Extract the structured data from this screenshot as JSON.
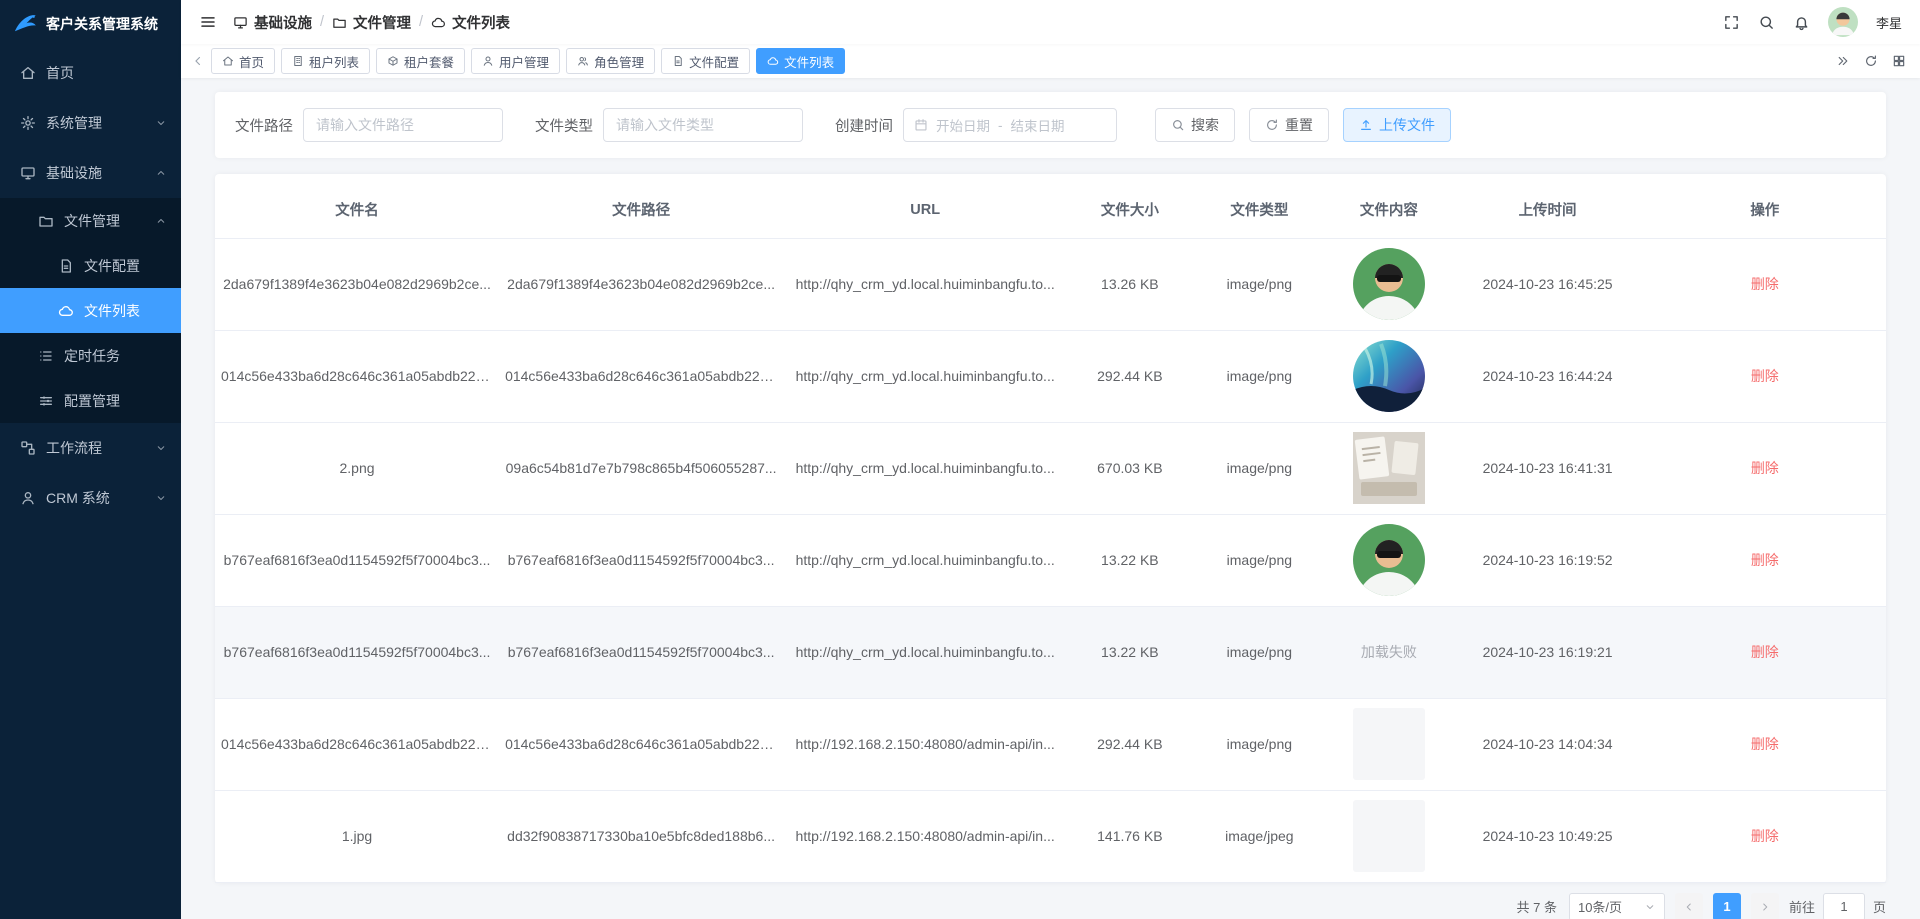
{
  "app": {
    "title": "客户关系管理系统"
  },
  "colors": {
    "accent": "#409eff",
    "sidebar_bg": "#0b2239",
    "danger": "#f56c6c"
  },
  "header": {
    "breadcrumb": [
      {
        "icon": "monitor",
        "label": "基础设施"
      },
      {
        "icon": "folder",
        "label": "文件管理"
      },
      {
        "icon": "cloud",
        "label": "文件列表"
      }
    ],
    "tools": [
      "fullscreen-icon",
      "search-icon",
      "bell-icon"
    ],
    "user_name": "李星"
  },
  "sidebar": {
    "items": [
      {
        "icon": "home",
        "label": "首页"
      },
      {
        "icon": "gear",
        "label": "系统管理"
      },
      {
        "icon": "monitor",
        "label": "基础设施"
      },
      {
        "icon": "folder",
        "label": "文件管理"
      },
      {
        "icon": "doc",
        "label": "文件配置"
      },
      {
        "icon": "cloud",
        "label": "文件列表"
      },
      {
        "icon": "list",
        "label": "定时任务"
      },
      {
        "icon": "sliders",
        "label": "配置管理"
      },
      {
        "icon": "flow",
        "label": "工作流程"
      },
      {
        "icon": "user",
        "label": "CRM 系统"
      }
    ]
  },
  "tabs": [
    {
      "icon": "home",
      "label": "首页"
    },
    {
      "icon": "building",
      "label": "租户列表"
    },
    {
      "icon": "package",
      "label": "租户套餐"
    },
    {
      "icon": "user",
      "label": "用户管理"
    },
    {
      "icon": "users",
      "label": "角色管理"
    },
    {
      "icon": "doc",
      "label": "文件配置"
    },
    {
      "icon": "cloud",
      "label": "文件列表",
      "active": true
    }
  ],
  "filters": {
    "path_label": "文件路径",
    "path_placeholder": "请输入文件路径",
    "type_label": "文件类型",
    "type_placeholder": "请输入文件类型",
    "time_label": "创建时间",
    "date_start": "开始日期",
    "date_separator": "-",
    "date_end": "结束日期",
    "search_label": "搜索",
    "reset_label": "重置",
    "upload_label": "上传文件"
  },
  "table": {
    "headers": [
      "文件名",
      "文件路径",
      "URL",
      "文件大小",
      "文件类型",
      "文件内容",
      "上传时间",
      "操作"
    ],
    "delete_label": "删除",
    "load_failed": "加载失败",
    "rows": [
      {
        "name": "2da679f1389f4e3623b04e082d2969b2ce...",
        "path": "2da679f1389f4e3623b04e082d2969b2ce...",
        "url": "http://qhy_crm_yd.local.huiminbangfu.to...",
        "size": "13.26 KB",
        "type": "image/png",
        "thumb": "avatar",
        "time": "2024-10-23 16:45:25"
      },
      {
        "name": "014c56e433ba6d28c646c361a05abdb225...",
        "path": "014c56e433ba6d28c646c361a05abdb225...",
        "url": "http://qhy_crm_yd.local.huiminbangfu.to...",
        "size": "292.44 KB",
        "type": "image/png",
        "thumb": "aurora",
        "time": "2024-10-23 16:44:24"
      },
      {
        "name": "2.png",
        "path": "09a6c54b81d7e7b798c865b4f506055287...",
        "url": "http://qhy_crm_yd.local.huiminbangfu.to...",
        "size": "670.03 KB",
        "type": "image/png",
        "thumb": "photo",
        "time": "2024-10-23 16:41:31"
      },
      {
        "name": "b767eaf6816f3ea0d1154592f5f70004bc3...",
        "path": "b767eaf6816f3ea0d1154592f5f70004bc3...",
        "url": "http://qhy_crm_yd.local.huiminbangfu.to...",
        "size": "13.22 KB",
        "type": "image/png",
        "thumb": "avatar",
        "time": "2024-10-23 16:19:52"
      },
      {
        "name": "b767eaf6816f3ea0d1154592f5f70004bc3...",
        "path": "b767eaf6816f3ea0d1154592f5f70004bc3...",
        "url": "http://qhy_crm_yd.local.huiminbangfu.to...",
        "size": "13.22 KB",
        "type": "image/png",
        "thumb": "failed",
        "time": "2024-10-23 16:19:21",
        "highlight": true
      },
      {
        "name": "014c56e433ba6d28c646c361a05abdb225...",
        "path": "014c56e433ba6d28c646c361a05abdb225...",
        "url": "http://192.168.2.150:48080/admin-api/in...",
        "size": "292.44 KB",
        "type": "image/png",
        "thumb": "blank",
        "time": "2024-10-23 14:04:34"
      },
      {
        "name": "1.jpg",
        "path": "dd32f90838717330ba10e5bfc8ded188b6...",
        "url": "http://192.168.2.150:48080/admin-api/in...",
        "size": "141.76 KB",
        "type": "image/jpeg",
        "thumb": "blank",
        "time": "2024-10-23 10:49:25"
      }
    ]
  },
  "pagination": {
    "total": "共 7 条",
    "page_size": "10条/页",
    "current_page": "1",
    "goto_label": "前往",
    "goto_value": "1",
    "page_label": "页"
  }
}
